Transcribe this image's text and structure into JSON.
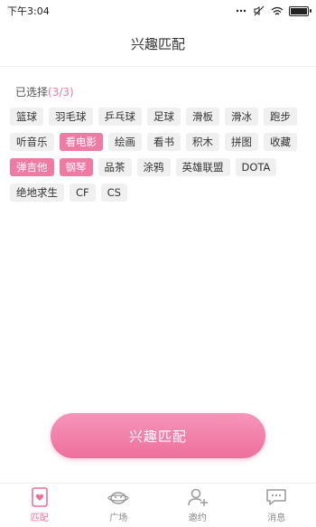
{
  "status_bar": {
    "time": "下午3:04"
  },
  "header": {
    "title": "兴趣匹配"
  },
  "selection": {
    "label": "已选择",
    "count": "(3/3)"
  },
  "tags": [
    {
      "label": "篮球",
      "selected": false
    },
    {
      "label": "羽毛球",
      "selected": false
    },
    {
      "label": "乒乓球",
      "selected": false
    },
    {
      "label": "足球",
      "selected": false
    },
    {
      "label": "滑板",
      "selected": false
    },
    {
      "label": "滑冰",
      "selected": false
    },
    {
      "label": "跑步",
      "selected": false
    },
    {
      "label": "听音乐",
      "selected": false
    },
    {
      "label": "看电影",
      "selected": true
    },
    {
      "label": "绘画",
      "selected": false
    },
    {
      "label": "看书",
      "selected": false
    },
    {
      "label": "积木",
      "selected": false
    },
    {
      "label": "拼图",
      "selected": false
    },
    {
      "label": "收藏",
      "selected": false
    },
    {
      "label": "弹吉他",
      "selected": true
    },
    {
      "label": "钢琴",
      "selected": true
    },
    {
      "label": "品茶",
      "selected": false
    },
    {
      "label": "涂鸦",
      "selected": false
    },
    {
      "label": "英雄联盟",
      "selected": false
    },
    {
      "label": "DOTA",
      "selected": false
    },
    {
      "label": "绝地求生",
      "selected": false
    },
    {
      "label": "CF",
      "selected": false
    },
    {
      "label": "CS",
      "selected": false
    }
  ],
  "actions": {
    "match_label": "兴趣匹配"
  },
  "bottom_nav": [
    {
      "label": "匹配",
      "icon": "match-icon",
      "active": true
    },
    {
      "label": "广场",
      "icon": "square-icon",
      "active": false
    },
    {
      "label": "邀约",
      "icon": "invite-icon",
      "active": false
    },
    {
      "label": "消息",
      "icon": "message-icon",
      "active": false
    }
  ],
  "colors": {
    "accent": "#ef7ba5",
    "tag_bg": "#f0f0f0"
  }
}
